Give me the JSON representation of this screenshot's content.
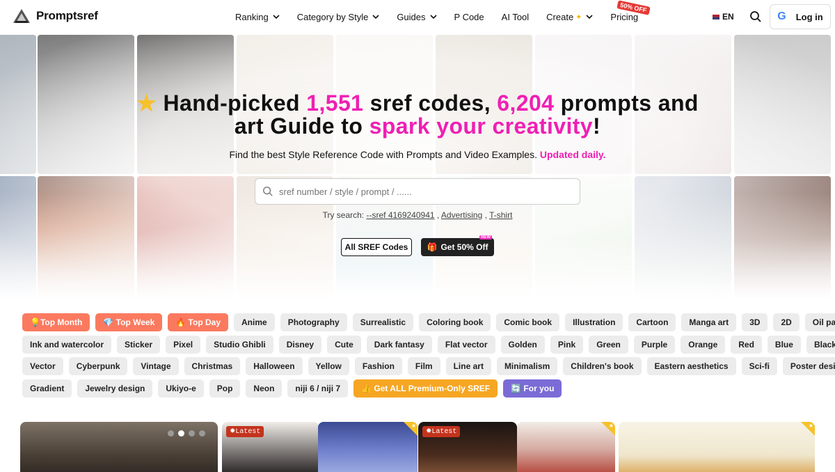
{
  "header": {
    "logo_text": "Promptsref",
    "nav": [
      {
        "label": "Ranking",
        "dropdown": true
      },
      {
        "label": "Category by Style",
        "dropdown": true
      },
      {
        "label": "Guides",
        "dropdown": true
      },
      {
        "label": "P Code",
        "dropdown": false
      },
      {
        "label": "AI Tool",
        "dropdown": false
      },
      {
        "label": "Create",
        "dropdown": true
      },
      {
        "label": "Pricing",
        "dropdown": false
      }
    ],
    "pricing_badge": "50% OFF",
    "language": "EN",
    "login_label": "Log in"
  },
  "hero": {
    "headline_pre": "Hand-picked ",
    "headline_num1": "1,551",
    "headline_mid": " sref codes, ",
    "headline_num2": "6,204",
    "headline_post": " prompts and",
    "headline_line2_pre": "art Guide to ",
    "headline_line2_pink": "spark your creativity",
    "headline_line2_post": "!",
    "subtitle": "Find the best Style Reference Code with Prompts and Video Examples.",
    "subtitle_highlight": "Updated daily.",
    "search_placeholder": "sref number / style / prompt / ......",
    "try_label": "Try search:",
    "try_links": [
      "--sref 4169240941",
      "Advertising",
      "T-shirt"
    ],
    "btn_all": "All SREF Codes",
    "btn_off": "Get 50% Off",
    "btn_off_tag": "NEW"
  },
  "tags": {
    "rows": [
      [
        "Top Month",
        "Top Week",
        "Top Day",
        "Anime",
        "Photography",
        "Surrealistic",
        "Coloring book",
        "Comic book",
        "Illustration",
        "Cartoon",
        "Manga art",
        "3D",
        "2D",
        "Oil painting"
      ],
      [
        "Ink and watercolor",
        "Sticker",
        "Pixel",
        "Studio Ghibli",
        "Disney",
        "Cute",
        "Dark fantasy",
        "Flat vector",
        "Golden",
        "Pink",
        "Green",
        "Purple",
        "Orange",
        "Red",
        "Blue",
        "Black"
      ],
      [
        "Vector",
        "Cyberpunk",
        "Vintage",
        "Christmas",
        "Halloween",
        "Yellow",
        "Fashion",
        "Film",
        "Line art",
        "Minimalism",
        "Children's book",
        "Eastern aesthetics",
        "Sci-fi",
        "Poster design"
      ],
      [
        "Gradient",
        "Jewelry design",
        "Ukiyo-e",
        "Pop",
        "Neon",
        "niji 6 / niji 7",
        "Get ALL Premium-Only SREF",
        "For you"
      ]
    ],
    "top_icons": [
      "💡",
      "💎",
      "🔥"
    ],
    "premium_icon": "👍",
    "foryou_icon": "🔄"
  },
  "cards": {
    "badge_latest": "Latest",
    "badge_icon": "✸"
  },
  "colors": {
    "pink": "#ef1fb4",
    "top_tag": "#fb7a5f",
    "premium": "#f6a623",
    "foryou": "#7b6bd6"
  }
}
